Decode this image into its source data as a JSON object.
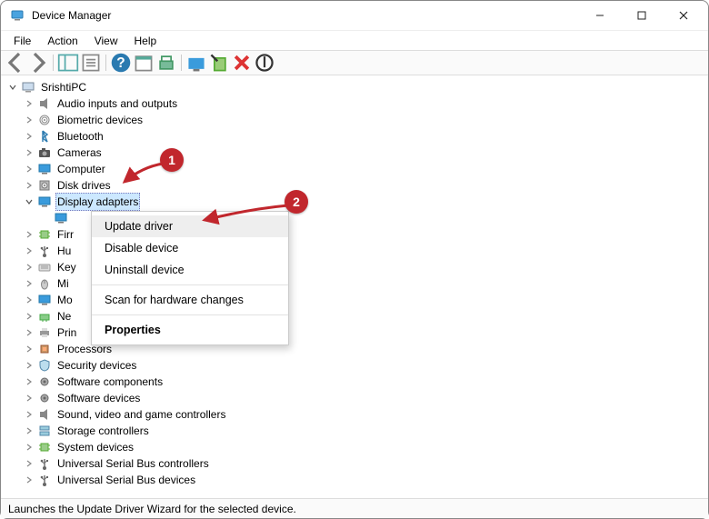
{
  "title": "Device Manager",
  "menu": {
    "file": "File",
    "action": "Action",
    "view": "View",
    "help": "Help"
  },
  "root": "SrishtiPC",
  "categories": [
    {
      "label": "Audio inputs and outputs",
      "icon": "speaker"
    },
    {
      "label": "Biometric devices",
      "icon": "fingerprint"
    },
    {
      "label": "Bluetooth",
      "icon": "bluetooth"
    },
    {
      "label": "Cameras",
      "icon": "camera"
    },
    {
      "label": "Computer",
      "icon": "monitor"
    },
    {
      "label": "Disk drives",
      "icon": "disk"
    },
    {
      "label": "Display adapters",
      "icon": "monitor",
      "selected": true,
      "expanded": true
    },
    {
      "label": "Firr",
      "icon": "chip",
      "cut": true
    },
    {
      "label": "Hu",
      "icon": "usb",
      "cut": true
    },
    {
      "label": "Key",
      "icon": "keyboard",
      "cut": true
    },
    {
      "label": "Mi",
      "icon": "mouse",
      "cut": true
    },
    {
      "label": "Mo",
      "icon": "monitor",
      "cut": true
    },
    {
      "label": "Ne",
      "icon": "net",
      "cut": true
    },
    {
      "label": "Prin",
      "icon": "printer",
      "cut": true
    },
    {
      "label": "Processors",
      "icon": "cpu"
    },
    {
      "label": "Security devices",
      "icon": "shield"
    },
    {
      "label": "Software components",
      "icon": "gear"
    },
    {
      "label": "Software devices",
      "icon": "gear"
    },
    {
      "label": "Sound, video and game controllers",
      "icon": "speaker"
    },
    {
      "label": "Storage controllers",
      "icon": "storage"
    },
    {
      "label": "System devices",
      "icon": "chip"
    },
    {
      "label": "Universal Serial Bus controllers",
      "icon": "usb"
    },
    {
      "label": "Universal Serial Bus devices",
      "icon": "usb"
    }
  ],
  "context_menu": {
    "items": [
      {
        "label": "Update driver",
        "hover": true
      },
      {
        "label": "Disable device"
      },
      {
        "label": "Uninstall device"
      }
    ],
    "scan": "Scan for hardware changes",
    "properties": "Properties"
  },
  "callouts": {
    "one": "1",
    "two": "2"
  },
  "status": "Launches the Update Driver Wizard for the selected device."
}
